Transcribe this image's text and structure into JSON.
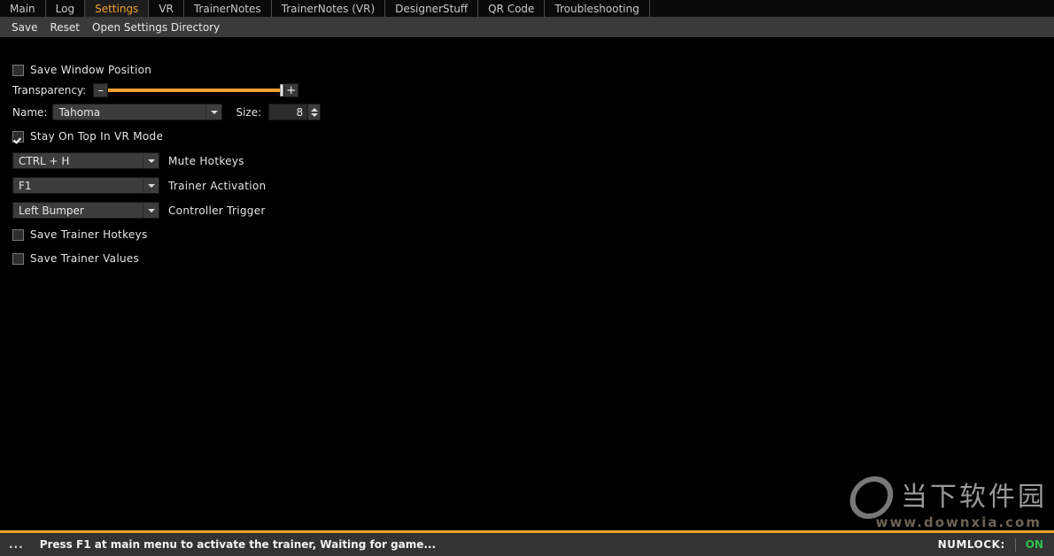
{
  "window": {
    "background": "#000000",
    "accent": "#f0a030"
  },
  "tabs": [
    {
      "label": "Main",
      "active": false
    },
    {
      "label": "Log",
      "active": false
    },
    {
      "label": "Settings",
      "active": true
    },
    {
      "label": "VR",
      "active": false
    },
    {
      "label": "TrainerNotes",
      "active": false
    },
    {
      "label": "TrainerNotes (VR)",
      "active": false
    },
    {
      "label": "DesignerStuff",
      "active": false
    },
    {
      "label": "QR Code",
      "active": false
    },
    {
      "label": "Troubleshooting",
      "active": false
    }
  ],
  "menubar": {
    "items": [
      {
        "label": "Save"
      },
      {
        "label": "Reset"
      },
      {
        "label": "Open Settings Directory"
      }
    ]
  },
  "settings": {
    "save_window_position": {
      "label": "Save Window Position",
      "checked": false
    },
    "transparency": {
      "label": "Transparency:",
      "minus_label": "–",
      "plus_label": "+",
      "value_percent": 100
    },
    "font": {
      "name_label": "Name:",
      "name_value": "Tahoma",
      "size_label": "Size:",
      "size_value": "8"
    },
    "stay_on_top": {
      "label": "Stay On Top In VR Mode",
      "checked": true
    },
    "hotkeys": [
      {
        "value": "CTRL + H",
        "caption": "Mute Hotkeys"
      },
      {
        "value": "F1",
        "caption": "Trainer Activation"
      },
      {
        "value": "Left Bumper",
        "caption": "Controller Trigger"
      }
    ],
    "save_trainer_hotkeys": {
      "label": "Save Trainer Hotkeys",
      "checked": false
    },
    "save_trainer_values": {
      "label": "Save Trainer Values",
      "checked": false
    }
  },
  "watermark": {
    "logo_text": "当下软件园",
    "url": "www.downxia.com"
  },
  "statusbar": {
    "dots": "...",
    "message": "Press F1 at main menu to activate the trainer, Waiting for game...",
    "numlock_label": "NUMLOCK:",
    "numlock_value": "ON",
    "numlock_color": "#2ec04a"
  }
}
